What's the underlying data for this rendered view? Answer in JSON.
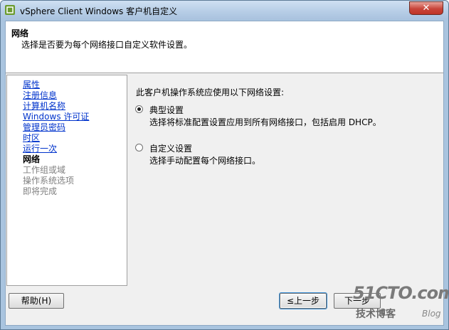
{
  "window": {
    "title": "vSphere Client Windows 客户机自定义",
    "close_glyph": "✕"
  },
  "header": {
    "title": "网络",
    "subtitle": "选择是否要为每个网络接口自定义软件设置。"
  },
  "nav": {
    "items": [
      {
        "label": "属性",
        "state": "link"
      },
      {
        "label": "注册信息",
        "state": "link"
      },
      {
        "label": "计算机名称",
        "state": "link"
      },
      {
        "label": "Windows 许可证",
        "state": "link"
      },
      {
        "label": "管理员密码",
        "state": "link"
      },
      {
        "label": "时区",
        "state": "link"
      },
      {
        "label": "运行一次",
        "state": "link"
      },
      {
        "label": "网络",
        "state": "current"
      },
      {
        "label": "工作组或域",
        "state": "disabled"
      },
      {
        "label": "操作系统选项",
        "state": "disabled"
      },
      {
        "label": "即将完成",
        "state": "disabled"
      }
    ]
  },
  "content": {
    "prompt": "此客户机操作系统应使用以下网络设置:",
    "options": [
      {
        "label": "典型设置",
        "description": "选择将标准配置设置应用到所有网络接口，包括启用 DHCP。",
        "selected": true
      },
      {
        "label": "自定义设置",
        "description": "选择手动配置每个网络接口。",
        "selected": false
      }
    ]
  },
  "buttons": {
    "help": "帮助(H)",
    "back": "≤上一步",
    "next": "下一步"
  },
  "watermark": {
    "logo": "51CTO.com",
    "tagline": "技术博客",
    "blog": "Blog"
  }
}
